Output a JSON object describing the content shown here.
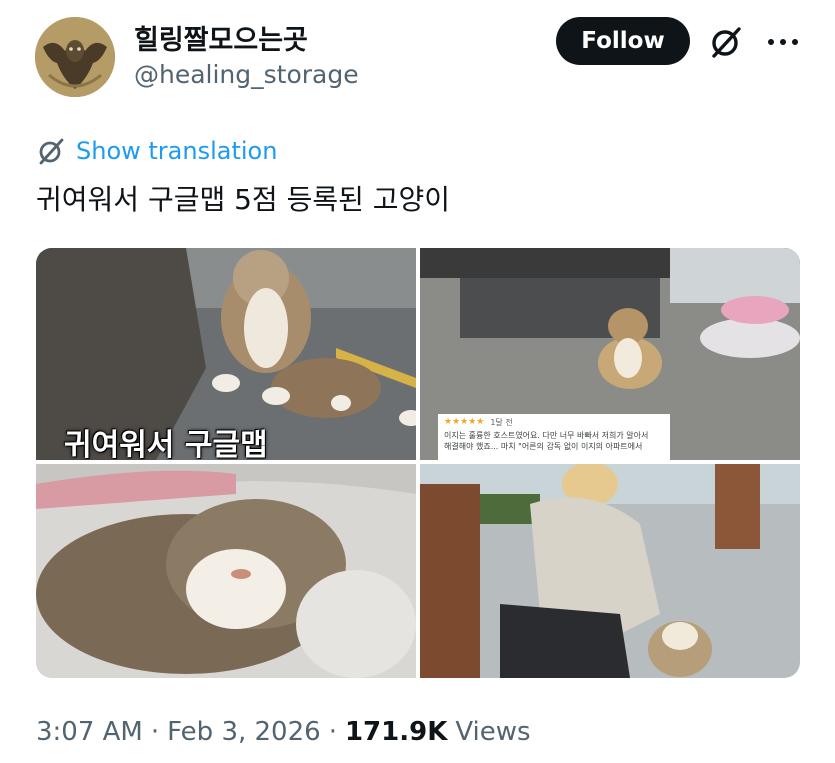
{
  "author": {
    "display_name": "힐링짤모으는곳",
    "handle": "@healing_storage",
    "follow_label": "Follow"
  },
  "translate": {
    "label": "Show translation"
  },
  "tweet": {
    "text": "귀여워서 구글맵 5점 등록된 고양이"
  },
  "media": {
    "photo1_caption": "귀여워서 구글맵",
    "review": {
      "stars": "★★★★★",
      "age": "1달 전",
      "lines": [
        "이지는 훌륭한 호스트였어요. 다만 너무 바빠서 저희가 알아서",
        "해결해야 했죠... 마치 \"어른의 감독 없이 이지의 아파트에서"
      ]
    }
  },
  "meta": {
    "time": "3:07 AM",
    "date": "Feb 3, 2026",
    "views_count": "171.9K",
    "views_label": "Views",
    "separator": "·"
  },
  "icons": {
    "grok": "grok-icon",
    "more": "more-icon",
    "translate": "translate-icon"
  },
  "colors": {
    "link": "#1d9bf0",
    "text": "#0f1419",
    "secondary": "#536471",
    "button": "#0f1419",
    "star": "#f5a623"
  }
}
